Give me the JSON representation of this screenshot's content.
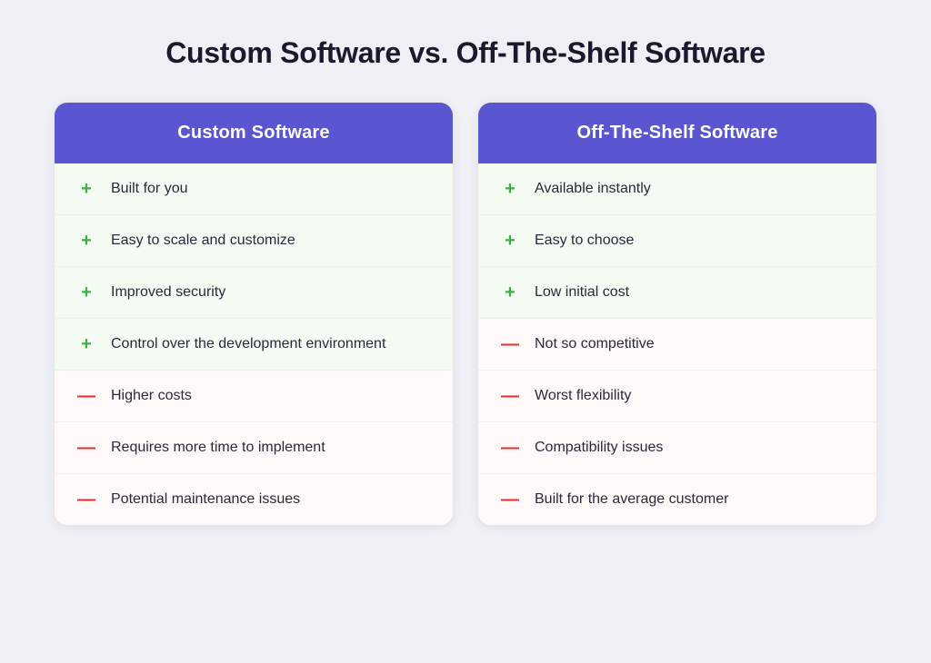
{
  "title": "Custom Software vs. Off-The-Shelf Software",
  "columns": [
    {
      "id": "custom",
      "header": "Custom Software",
      "items": [
        {
          "type": "positive",
          "text": "Built for you"
        },
        {
          "type": "positive",
          "text": "Easy to scale and customize"
        },
        {
          "type": "positive",
          "text": "Improved security"
        },
        {
          "type": "positive",
          "text": "Control over the development environment"
        },
        {
          "type": "negative",
          "text": "Higher costs"
        },
        {
          "type": "negative",
          "text": "Requires more time to implement"
        },
        {
          "type": "negative",
          "text": "Potential maintenance issues"
        }
      ]
    },
    {
      "id": "offshelf",
      "header": "Off-The-Shelf Software",
      "items": [
        {
          "type": "positive",
          "text": "Available instantly"
        },
        {
          "type": "positive",
          "text": "Easy to choose"
        },
        {
          "type": "positive",
          "text": "Low initial cost"
        },
        {
          "type": "negative",
          "text": "Not so competitive"
        },
        {
          "type": "negative",
          "text": "Worst flexibility"
        },
        {
          "type": "negative",
          "text": "Compatibility issues"
        },
        {
          "type": "negative",
          "text": "Built for the average customer"
        }
      ]
    }
  ]
}
